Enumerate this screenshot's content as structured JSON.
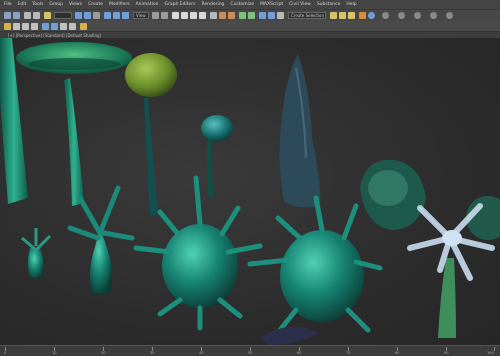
{
  "menu": {
    "items": [
      "File",
      "Edit",
      "Tools",
      "Group",
      "Views",
      "Create",
      "Modifiers",
      "Animation",
      "Graph Editors",
      "Rendering",
      "Customize",
      "MAXScript",
      "Civil View",
      "Substance",
      "Help"
    ]
  },
  "toolbar": {
    "view_dropdown": "View",
    "selection_set": "Create Selection Set"
  },
  "viewport": {
    "label": "[+] [Perspective] [Standard] [Default Shading]"
  },
  "timeline": {
    "ticks": [
      "0",
      "10",
      "20",
      "30",
      "40",
      "50",
      "60",
      "70",
      "80",
      "90",
      "100"
    ]
  },
  "colors": {
    "ui_dark": "#444444",
    "viewport_bg": "#2b2b2b",
    "plant_teal": "#1f8a7a",
    "plant_green": "#7aa33a"
  }
}
